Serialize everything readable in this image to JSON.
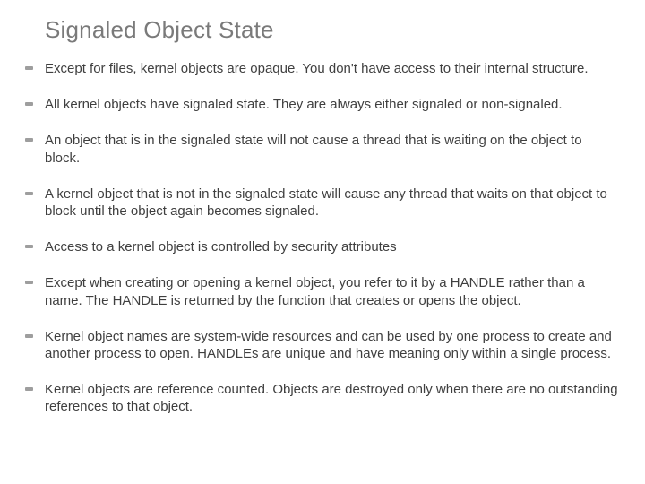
{
  "title": "Signaled Object State",
  "bullets": [
    "Except for files, kernel objects are opaque.  You don't have access to their internal structure.",
    "All kernel objects have signaled state.  They are always either signaled or non-signaled.",
    "An object that is in the signaled state will not cause a thread that is waiting on the object to block.",
    "A kernel object that is not in the signaled state will cause any thread that waits on that object to block until the object again becomes signaled.",
    "Access to a kernel object is controlled by security attributes",
    "Except when creating or opening a kernel object, you refer to it by a HANDLE rather than a name.  The HANDLE is returned by the function that creates or opens the object.",
    "Kernel object names are system-wide resources and can be used by one process to create and another process to open.  HANDLEs are unique and have meaning only within a single process.",
    "Kernel objects are reference counted.  Objects are destroyed only when there are no outstanding references to that object."
  ]
}
